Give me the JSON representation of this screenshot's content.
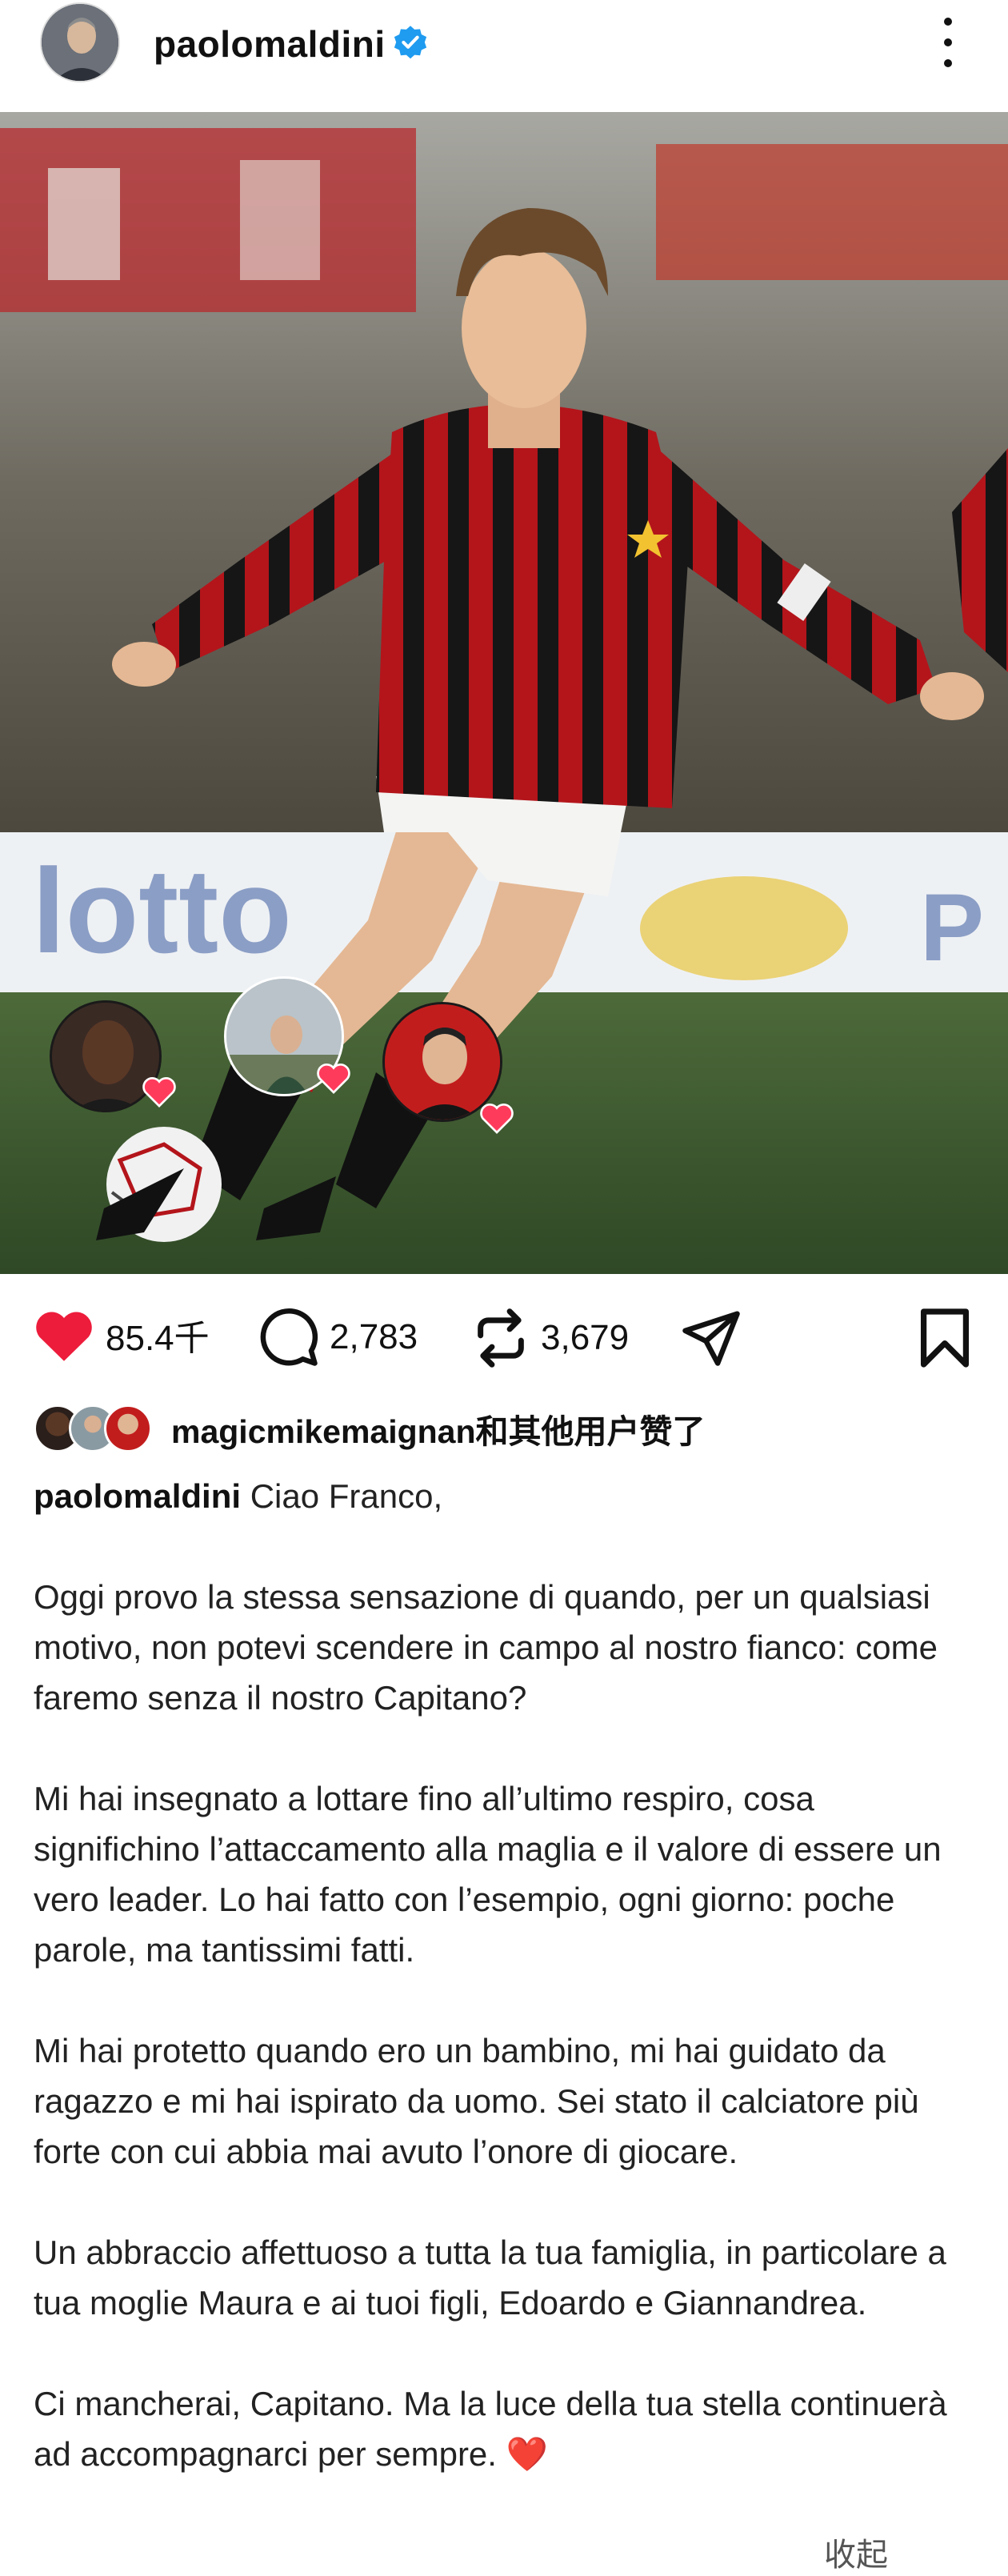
{
  "header": {
    "username": "paolomaldini"
  },
  "post": {
    "likes": "85.4千",
    "comments": "2,783",
    "reposts": "3,679"
  },
  "liked_by": {
    "text": "magicmikemaignan和其他用户赞了"
  },
  "caption": {
    "username": "paolomaldini",
    "first_line": "Ciao Franco,",
    "paragraphs": [
      "Oggi provo la stessa sensazione di quando, per un qualsiasi motivo, non potevi scendere in campo al nostro fianco: come faremo senza il nostro Capitano?",
      "Mi hai insegnato a lottare fino all’ultimo respiro, cosa significhino l’attaccamento alla maglia e il valore di essere un vero leader. Lo hai fatto con l’esempio, ogni giorno: poche parole, ma tantissimi fatti.",
      "Mi hai protetto quando ero un bambino, mi hai guidato da ragazzo e mi hai ispirato da uomo. Sei stato il calciatore più forte con cui abbia mai avuto l’onore di giocare.",
      "Un abbraccio affettuoso a tutta la tua famiglia, in particolare a tua moglie Maura e ai tuoi figli, Edoardo e Giannandrea.",
      "Ci mancherai, Capitano. Ma la luce della tua stella continuerà ad accompagnarci per sempre. ❤️"
    ]
  },
  "watermark": "收起",
  "icons": {
    "verified": "verified-badge-icon",
    "more": "more-options-icon",
    "like": "heart-icon",
    "comment": "comment-icon",
    "repost": "repost-icon",
    "share": "send-icon",
    "save": "bookmark-icon"
  },
  "colors": {
    "like": "#ed1c3b",
    "verified": "#1f9bf0",
    "text": "#111111"
  }
}
